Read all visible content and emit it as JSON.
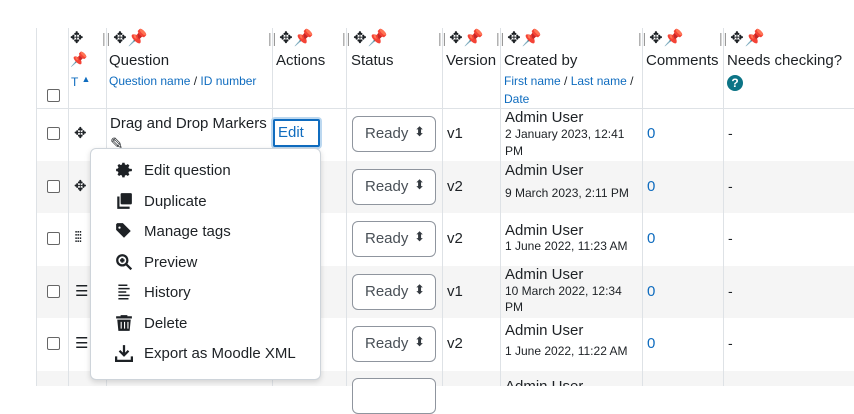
{
  "header_tools": {
    "move": "✥",
    "pin": "📌",
    "grip": "||"
  },
  "columns": {
    "select": {
      "sort_label": "T",
      "sort_arrow": "▲"
    },
    "question": {
      "label": "Question",
      "sub1": "Question name",
      "sep": " / ",
      "sub2": "ID number"
    },
    "actions": {
      "label": "Actions"
    },
    "status": {
      "label": "Status"
    },
    "version": {
      "label": "Version"
    },
    "created_by": {
      "label": "Created by",
      "sub1": "First name",
      "sep": " / ",
      "sub2": "Last name",
      "sep2": " /",
      "sub3": "Date"
    },
    "comments": {
      "label": "Comments"
    },
    "needs_checking": {
      "label": "Needs checking?",
      "help": "?"
    }
  },
  "rows": [
    {
      "name": "Drag and Drop Markers",
      "status": "Ready",
      "version": "v1",
      "author": "Admin User",
      "date": "2 January 2023, 12:41",
      "date2": "PM",
      "comments": "0",
      "needs": "-"
    },
    {
      "name": "",
      "status": "Ready",
      "version": "v2",
      "author": "Admin User",
      "date": "9 March 2023, 2:11 PM",
      "date2": "",
      "comments": "0",
      "needs": "-"
    },
    {
      "name": "",
      "status": "Ready",
      "version": "v2",
      "author": "Admin User",
      "date": "1 June 2022, 11:23 AM",
      "date2": "",
      "comments": "0",
      "needs": "-"
    },
    {
      "name": "",
      "status": "Ready",
      "version": "v1",
      "author": "Admin User",
      "date": "10 March 2022, 12:34",
      "date2": "PM",
      "comments": "0",
      "needs": "-"
    },
    {
      "name": "",
      "status": "Ready",
      "version": "v2",
      "author": "Admin User",
      "date": "1 June 2022, 11:22 AM",
      "date2": "",
      "comments": "0",
      "needs": "-"
    }
  ],
  "partial_row": {
    "author": "Admin User"
  },
  "actions_button": {
    "label": "Edit",
    "caret": "⌄"
  },
  "actions_menu": [
    {
      "label": "Edit question",
      "icon": "gear-icon"
    },
    {
      "label": "Duplicate",
      "icon": "copy-icon"
    },
    {
      "label": "Manage tags",
      "icon": "tag-icon"
    },
    {
      "label": "Preview",
      "icon": "magnify-plus-icon"
    },
    {
      "label": "History",
      "icon": "history-lines-icon"
    },
    {
      "label": "Delete",
      "icon": "trash-icon"
    },
    {
      "label": "Export as Moodle XML",
      "icon": "download-icon"
    }
  ],
  "colors": {
    "link": "#0f6cbf",
    "help": "#0c7486",
    "stripe": "#f5f5f5"
  }
}
